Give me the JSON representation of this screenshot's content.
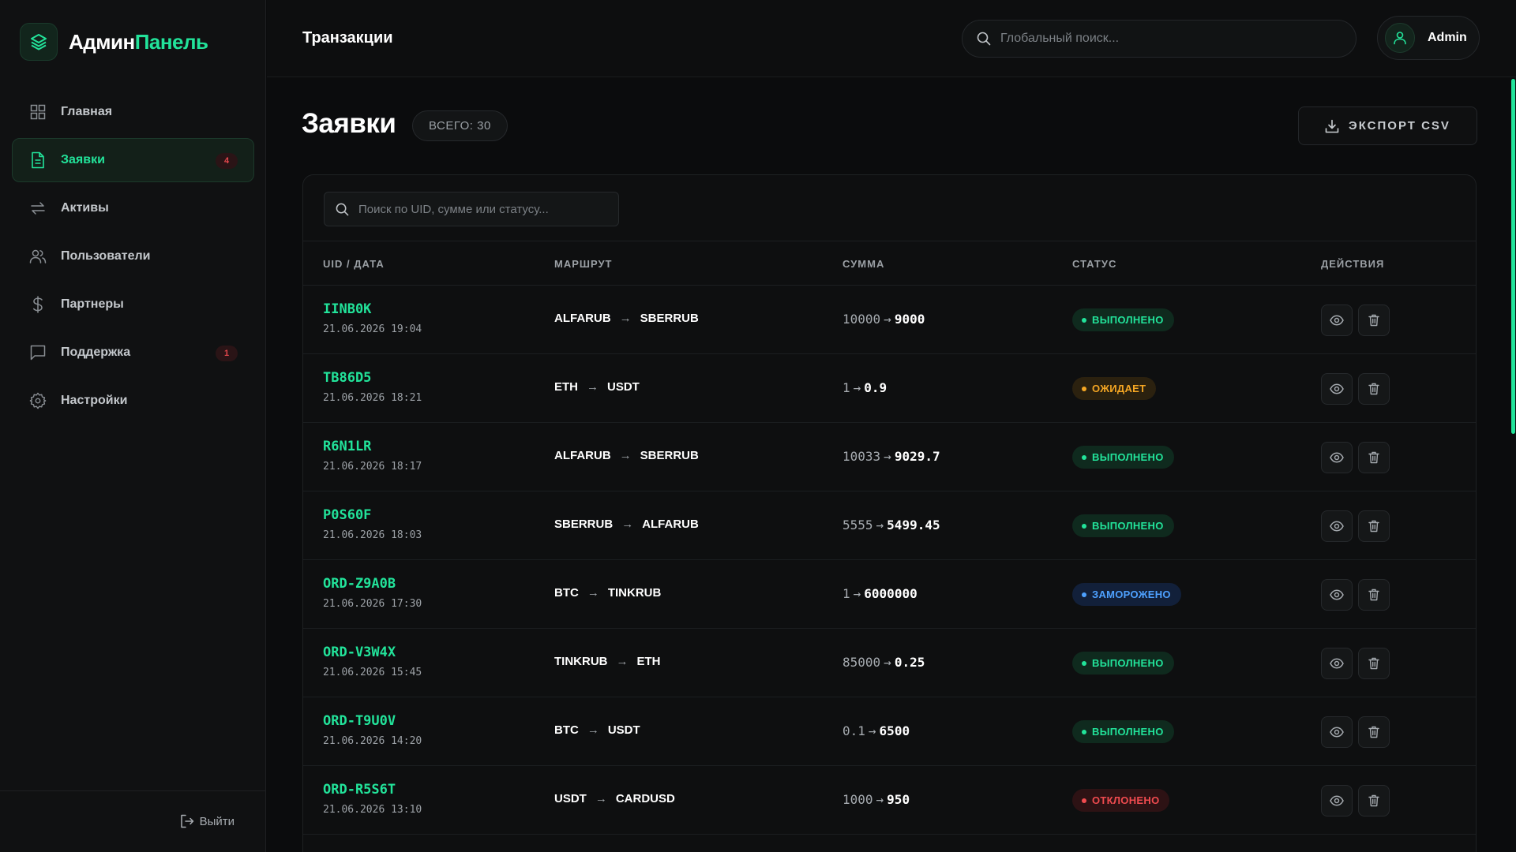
{
  "brand": {
    "part1": "Админ",
    "part2": "Панель",
    "accent_color": "#22e39a",
    "icon": "layers-icon"
  },
  "sidebar": {
    "items": [
      {
        "label": "Главная",
        "icon": "grid-icon",
        "active": false
      },
      {
        "label": "Заявки",
        "icon": "document-icon",
        "active": true,
        "badge": "4"
      },
      {
        "label": "Активы",
        "icon": "arrows-exchange-icon",
        "active": false
      },
      {
        "label": "Пользователи",
        "icon": "users-icon",
        "active": false
      },
      {
        "label": "Партнеры",
        "icon": "dollar-icon",
        "active": false
      },
      {
        "label": "Поддержка",
        "icon": "chat-icon",
        "active": false,
        "badge": "1"
      },
      {
        "label": "Настройки",
        "icon": "gear-icon",
        "active": false
      }
    ],
    "logout_label": "Выйти"
  },
  "topbar": {
    "title": "Транзакции",
    "search_placeholder": "Глобальный поиск...",
    "user_name": "Admin"
  },
  "page": {
    "title": "Заявки",
    "total_label": "ВСЕГО: 30",
    "export_label": "ЭКСПОРТ CSV"
  },
  "table": {
    "search_placeholder": "Поиск по UID, сумме или статусу...",
    "columns": [
      "UID / ДАТА",
      "МАРШРУТ",
      "СУММА",
      "СТАТУС",
      "ДЕЙСТВИЯ"
    ],
    "rows": [
      {
        "uid": "IINB0K",
        "date": "21.06.2026 19:04",
        "from": "ALFARUB",
        "to": "SBERRUB",
        "amount_from": "10000",
        "amount_to": "9000",
        "status": "ВЫПОЛНЕНО",
        "status_kind": "done"
      },
      {
        "uid": "TB86D5",
        "date": "21.06.2026 18:21",
        "from": "ETH",
        "to": "USDT",
        "amount_from": "1",
        "amount_to": "0.9",
        "status": "ОЖИДАЕТ",
        "status_kind": "wait"
      },
      {
        "uid": "R6N1LR",
        "date": "21.06.2026 18:17",
        "from": "ALFARUB",
        "to": "SBERRUB",
        "amount_from": "10033",
        "amount_to": "9029.7",
        "status": "ВЫПОЛНЕНО",
        "status_kind": "done"
      },
      {
        "uid": "P0S60F",
        "date": "21.06.2026 18:03",
        "from": "SBERRUB",
        "to": "ALFARUB",
        "amount_from": "5555",
        "amount_to": "5499.45",
        "status": "ВЫПОЛНЕНО",
        "status_kind": "done"
      },
      {
        "uid": "ORD-Z9A0B",
        "date": "21.06.2026 17:30",
        "from": "BTC",
        "to": "TINKRUB",
        "amount_from": "1",
        "amount_to": "6000000",
        "status": "ЗАМОРОЖЕНО",
        "status_kind": "frozen"
      },
      {
        "uid": "ORD-V3W4X",
        "date": "21.06.2026 15:45",
        "from": "TINKRUB",
        "to": "ETH",
        "amount_from": "85000",
        "amount_to": "0.25",
        "status": "ВЫПОЛНЕНО",
        "status_kind": "done"
      },
      {
        "uid": "ORD-T9U0V",
        "date": "21.06.2026 14:20",
        "from": "BTC",
        "to": "USDT",
        "amount_from": "0.1",
        "amount_to": "6500",
        "status": "ВЫПОЛНЕНО",
        "status_kind": "done"
      },
      {
        "uid": "ORD-R5S6T",
        "date": "21.06.2026 13:10",
        "from": "USDT",
        "to": "CARDUSD",
        "amount_from": "1000",
        "amount_to": "950",
        "status": "ОТКЛОНЕНО",
        "status_kind": "rejected"
      }
    ]
  },
  "colors": {
    "accent": "#22e39a",
    "warning": "#f5a623",
    "info": "#4ea1ff",
    "danger": "#f04b4f",
    "background": "#0b0c0d"
  }
}
